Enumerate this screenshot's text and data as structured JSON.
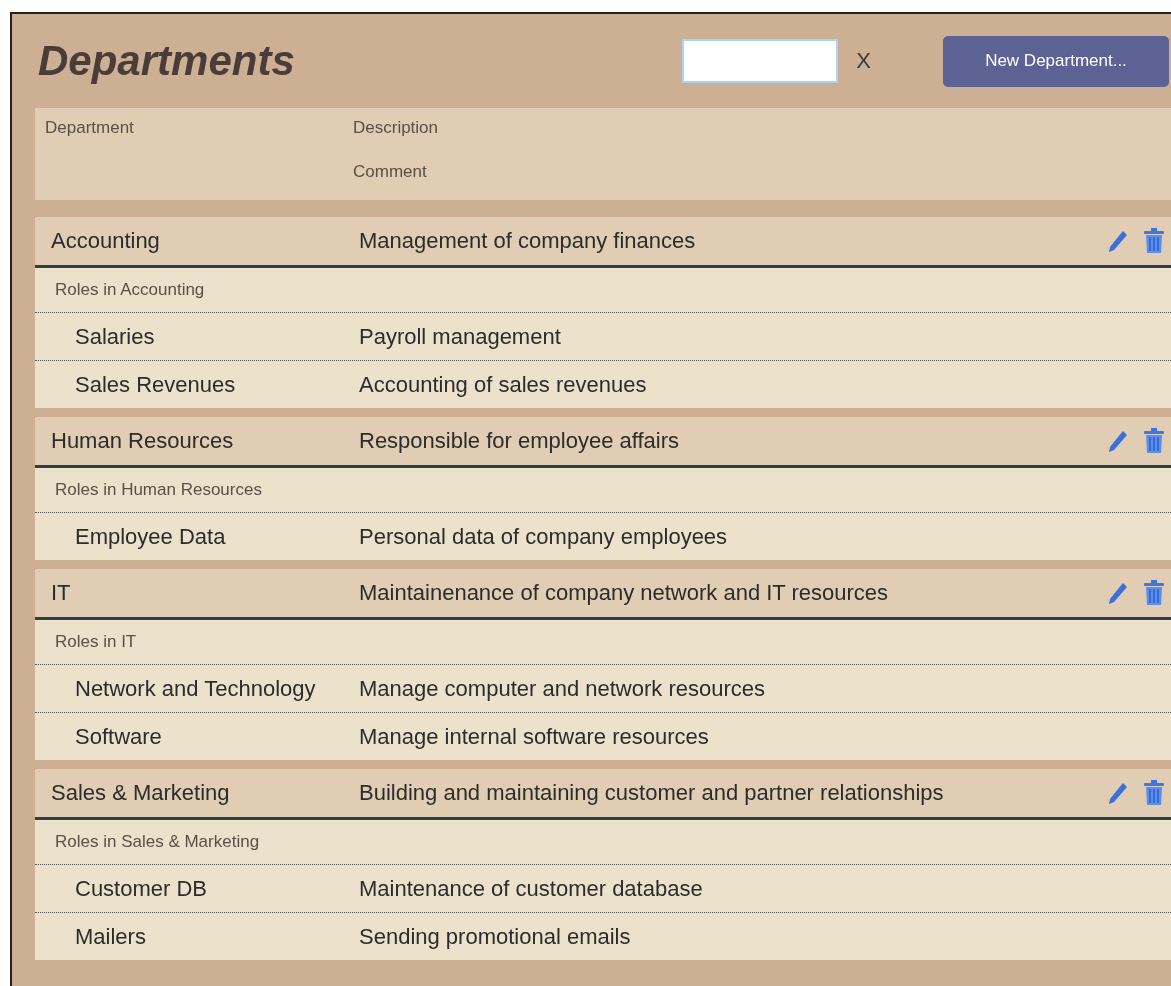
{
  "title": "Departments",
  "clear_label": "X",
  "new_button": "New Department...",
  "columns": {
    "department": "Department",
    "description": "Description",
    "comment": "Comment"
  },
  "departments": [
    {
      "name": "Accounting",
      "description": "Management of company finances",
      "roles_label": "Roles in Accounting",
      "roles": [
        {
          "name": "Salaries",
          "description": "Payroll management"
        },
        {
          "name": "Sales Revenues",
          "description": "Accounting of sales revenues"
        }
      ]
    },
    {
      "name": "Human Resources",
      "description": "Responsible for employee affairs",
      "roles_label": "Roles in Human Resources",
      "roles": [
        {
          "name": "Employee Data",
          "description": "Personal data of company employees"
        }
      ]
    },
    {
      "name": "IT",
      "description": "Maintainenance of company network and IT resources",
      "roles_label": "Roles in IT",
      "roles": [
        {
          "name": "Network and Technology",
          "description": "Manage computer and network resources"
        },
        {
          "name": "Software",
          "description": "Manage internal software resources"
        }
      ]
    },
    {
      "name": "Sales & Marketing",
      "description": "Building and maintaining customer and partner relationships",
      "roles_label": "Roles in Sales & Marketing",
      "roles": [
        {
          "name": "Customer DB",
          "description": "Maintenance of customer database"
        },
        {
          "name": "Mailers",
          "description": "Sending promotional emails"
        }
      ]
    }
  ]
}
